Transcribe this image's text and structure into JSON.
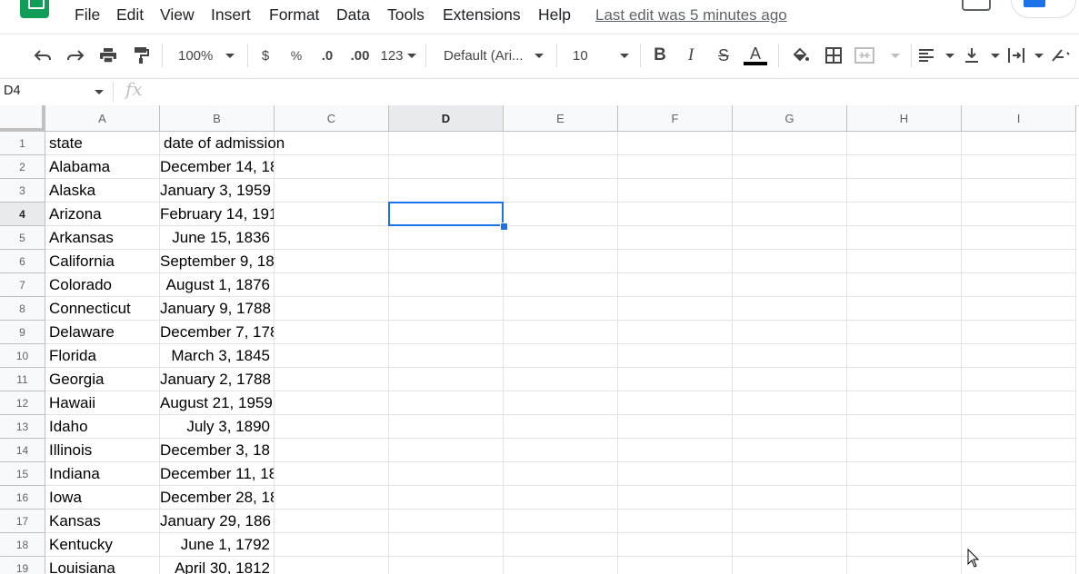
{
  "menu": {
    "items": [
      "File",
      "Edit",
      "View",
      "Insert",
      "Format",
      "Data",
      "Tools",
      "Extensions",
      "Help"
    ],
    "last_edit": "Last edit was 5 minutes ago"
  },
  "toolbar": {
    "zoom": "100%",
    "currency": "$",
    "percent": "%",
    "decrease_decimal": ".0",
    "increase_decimal": ".00",
    "more_formats": "123",
    "font": "Default (Ari...",
    "font_size": "10",
    "bold": "B",
    "italic": "I",
    "strikethrough": "S",
    "text_color_label": "A",
    "colors": {
      "accent": "#1a73e8",
      "logo": "#0f9d58"
    }
  },
  "formula_bar": {
    "name_box": "D4",
    "fx": "fx",
    "formula": ""
  },
  "grid": {
    "selected_cell": "D4",
    "columns": [
      "A",
      "B",
      "C",
      "D",
      "E",
      "F",
      "G",
      "H",
      "I"
    ],
    "rows": [
      {
        "num": "1",
        "a": "state",
        "b": "date of admission"
      },
      {
        "num": "2",
        "a": "Alabama",
        "b": "December 14, 18"
      },
      {
        "num": "3",
        "a": "Alaska",
        "b": "January 3, 1959"
      },
      {
        "num": "4",
        "a": "Arizona",
        "b": "February 14, 191"
      },
      {
        "num": "5",
        "a": "Arkansas",
        "b": "June 15, 1836"
      },
      {
        "num": "6",
        "a": "California",
        "b": "September 9, 18"
      },
      {
        "num": "7",
        "a": "Colorado",
        "b": "August 1, 1876"
      },
      {
        "num": "8",
        "a": "Connecticut",
        "b": "January 9, 1788"
      },
      {
        "num": "9",
        "a": "Delaware",
        "b": "December 7, 178"
      },
      {
        "num": "10",
        "a": "Florida",
        "b": "March 3, 1845"
      },
      {
        "num": "11",
        "a": "Georgia",
        "b": "January 2, 1788"
      },
      {
        "num": "12",
        "a": "Hawaii",
        "b": "August 21, 1959"
      },
      {
        "num": "13",
        "a": "Idaho",
        "b": "July 3, 1890"
      },
      {
        "num": "14",
        "a": "Illinois",
        "b": "December 3, 18"
      },
      {
        "num": "15",
        "a": "Indiana",
        "b": "December 11, 18"
      },
      {
        "num": "16",
        "a": "Iowa",
        "b": "December 28, 18"
      },
      {
        "num": "17",
        "a": "Kansas",
        "b": "January 29, 186"
      },
      {
        "num": "18",
        "a": "Kentucky",
        "b": "June 1, 1792"
      },
      {
        "num": "19",
        "a": "Louisiana",
        "b": "April 30, 1812"
      }
    ]
  }
}
